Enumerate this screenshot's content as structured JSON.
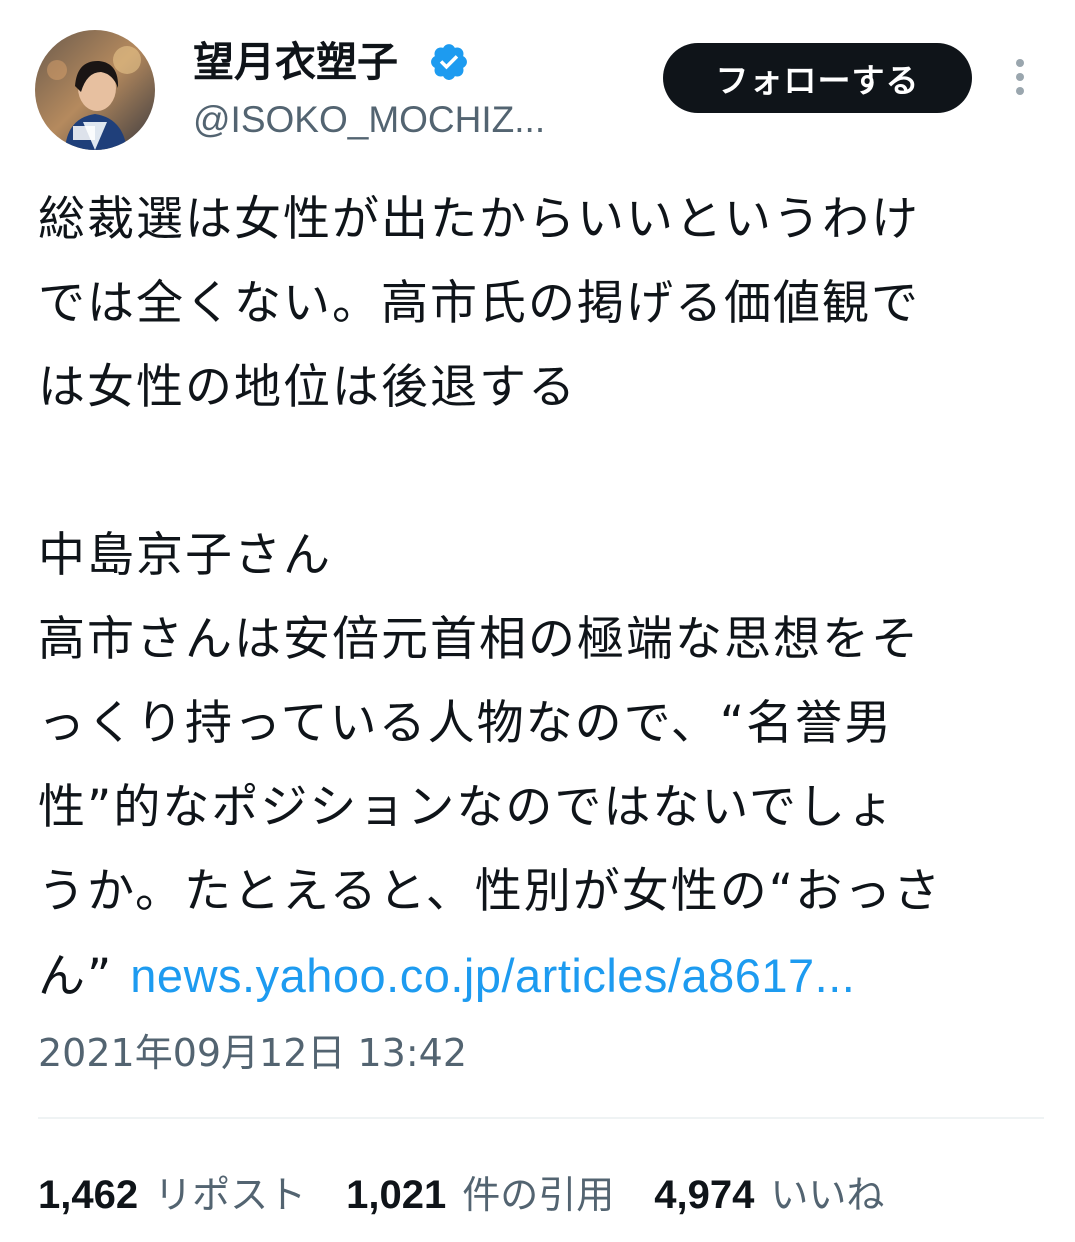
{
  "author": {
    "name": "望月衣塑子",
    "handle": "@ISOKO_MOCHIZ..."
  },
  "follow_button_label": "フォローする",
  "tweet": {
    "lines": [
      "総裁選は女性が出たからいいというわけ",
      "では全くない。高市氏の掲げる価値観で",
      "は女性の地位は後退する",
      "中島京子さん",
      "高市さんは安倍元首相の極端な思想をそ",
      "っくり持っている人物なので、“名誉男",
      "性”的なポジションなのではないでしょ",
      "うか。たとえると、性別が女性の“おっさ"
    ],
    "last_line_text": "ん” ",
    "link_text": "news.yahoo.co.jp/articles/a8617..."
  },
  "timestamp": "2021年09月12日 13:42",
  "stats": {
    "reposts_count": "1,462",
    "reposts_label": "リポスト",
    "quotes_count": "1,021",
    "quotes_label": "件の引用",
    "likes_count": "4,974",
    "likes_label": "いいね"
  },
  "colors": {
    "primary_text": "#0f1419",
    "secondary_text": "#536471",
    "link": "#1d9bf0",
    "verified_badge": "#1d9bf0",
    "button_bg": "#0f1419",
    "divider": "#eff3f4"
  },
  "icons": {
    "verified": "verified-badge-icon",
    "more": "more-vertical-icon"
  }
}
